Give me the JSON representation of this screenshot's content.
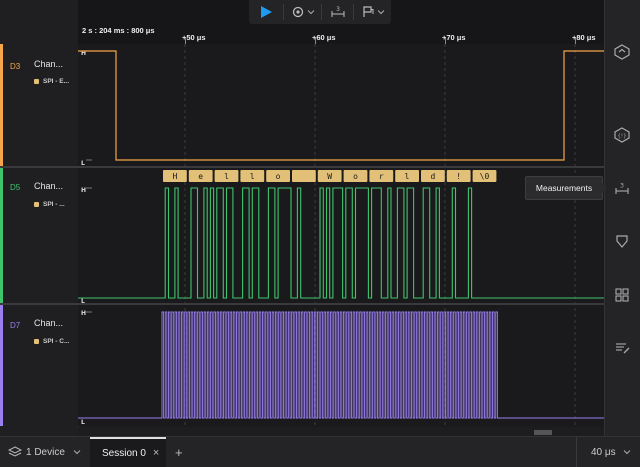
{
  "toolbar": {
    "play_icon": "play-icon",
    "sample_icon": "gear-icon",
    "measure_glyph": "3",
    "trigger_icon": "flag-icon"
  },
  "ruler": {
    "time_origin": "2 s : 204 ms : 800 μs",
    "ticks": [
      {
        "label": "+50 μs",
        "value_us": 50
      },
      {
        "label": "+60 μs",
        "value_us": 60
      },
      {
        "label": "+70 μs",
        "value_us": 70
      },
      {
        "label": "+80 μs",
        "value_us": 80
      }
    ]
  },
  "channels": [
    {
      "id": "D3",
      "name": "Chan...",
      "analyzer": "SPI - E...",
      "color": "#f5a54a",
      "high": "H",
      "low": "L"
    },
    {
      "id": "D5",
      "name": "Chan...",
      "analyzer": "SPI - ...",
      "color": "#3ec46d",
      "high": "H",
      "low": "L"
    },
    {
      "id": "D7",
      "name": "Chan...",
      "analyzer": "SPI - C...",
      "color": "#9b7ff0",
      "high": "H",
      "low": "L"
    }
  ],
  "decoded_bytes": [
    "H",
    "e",
    "l",
    "l",
    "o",
    " ",
    "W",
    "o",
    "r",
    "l",
    "d",
    "!",
    "\\0"
  ],
  "tooltip": {
    "text": "Measurements"
  },
  "right_sidebar": [
    {
      "icon": "analyzers-icon"
    },
    {
      "icon": "extensions-icon"
    },
    {
      "icon": "measurements-icon",
      "glyph": "3"
    },
    {
      "icon": "notes-icon"
    },
    {
      "icon": "layout-icon"
    },
    {
      "icon": "annotations-icon"
    }
  ],
  "bottom": {
    "device_label": "1 Device",
    "session_tab": "Session 0",
    "close_glyph": "×",
    "add_glyph": "+",
    "zoom_label": "40 μs"
  }
}
